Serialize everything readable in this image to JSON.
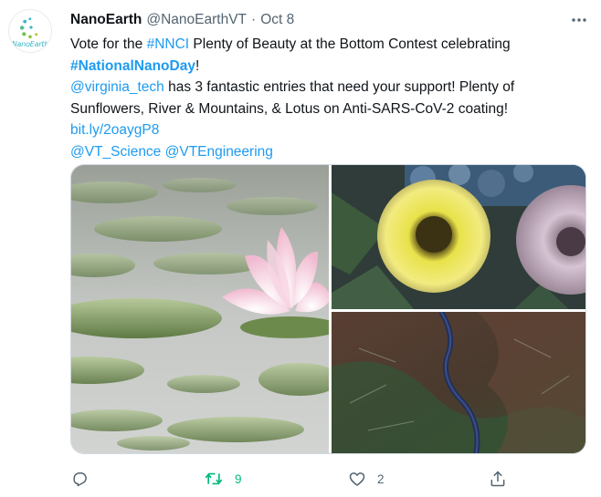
{
  "author": {
    "display_name": "NanoEarth",
    "handle": "@NanoEarthVT",
    "separator": "·",
    "date": "Oct 8",
    "avatar_text": "NanoEarth"
  },
  "tweet": {
    "line1_a": "Vote for the ",
    "line1_hashtag": "#NNCI",
    "line1_b": " Plenty of Beauty at the Bottom Contest celebrating",
    "line2_hashtag": "#NationalNanoDay",
    "line2_b": "!",
    "line3_mention": "@virginia_tech",
    "line3_b": " has 3 fantastic entries that need your support! Plenty of",
    "line4": "Sunflowers, River & Mountains, & Lotus on Anti-SARS-CoV-2 coating!",
    "link": "bit.ly/2oaygP8",
    "mention_a": "@VT_Science",
    "mention_sep": " ",
    "mention_b": "@VTEngineering"
  },
  "actions": {
    "reply_count": "",
    "retweet_count": "9",
    "like_count": "2"
  },
  "icons": {
    "more": "more-icon",
    "reply": "reply-icon",
    "retweet": "retweet-icon",
    "like": "like-icon",
    "share": "share-icon"
  },
  "colors": {
    "link": "#1d9bf0",
    "retweeted": "#00ba7c",
    "secondary_text": "#536471",
    "primary_text": "#0f1419"
  }
}
